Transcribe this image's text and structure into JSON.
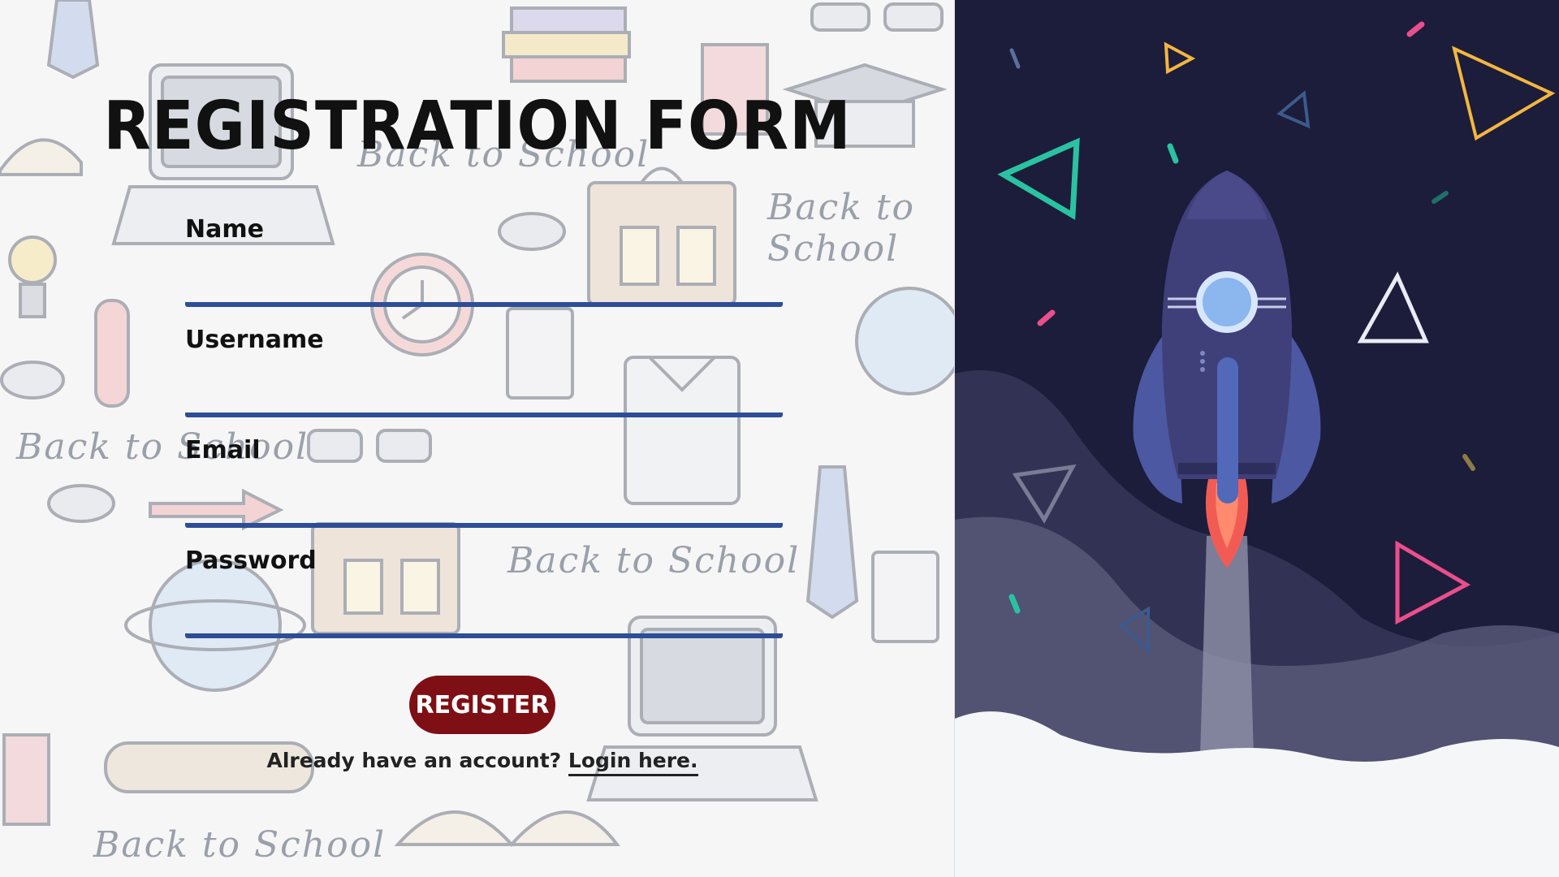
{
  "form": {
    "title": "Registration Form",
    "fields": [
      {
        "label": "Name",
        "value": "",
        "placeholder": ""
      },
      {
        "label": "Username",
        "value": "",
        "placeholder": ""
      },
      {
        "label": "Email",
        "value": "",
        "placeholder": ""
      },
      {
        "label": "Password",
        "value": "",
        "placeholder": ""
      }
    ],
    "register_label": "REGISTER",
    "account_prompt": "Already have an account?",
    "login_link_label": "Login here."
  },
  "background": {
    "doodle_caption": "Back to School"
  },
  "colors": {
    "accent_blue": "#2d4e97",
    "button_red": "#7e0f14",
    "space_bg": "#1c1c3b",
    "rocket_body": "#3f3f7a",
    "cloud": "#f5f6f8",
    "triangle_teal": "#2ac3a2",
    "triangle_yellow": "#f3b63f",
    "triangle_pink": "#ea4f8b",
    "triangle_white": "#e9ecf4"
  },
  "icons": [
    "rocket-icon",
    "triangle-icon"
  ]
}
